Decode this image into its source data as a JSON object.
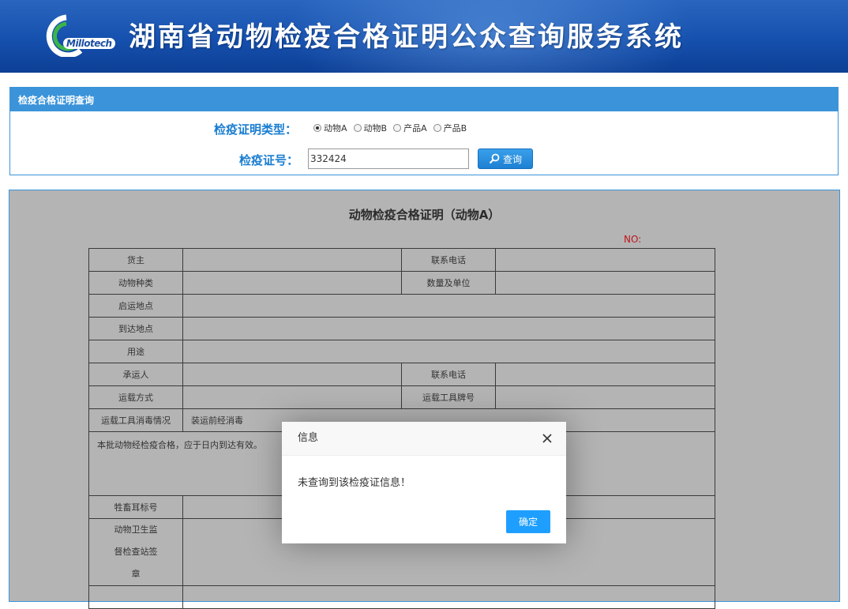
{
  "header": {
    "logo_text": "Millotech",
    "site_title": "湖南省动物检疫合格证明公众查询服务系统"
  },
  "query": {
    "panel_title": "检疫合格证明查询",
    "type_label": "检疫证明类型：",
    "types": [
      {
        "label": "动物A",
        "checked": true
      },
      {
        "label": "动物B",
        "checked": false
      },
      {
        "label": "产品A",
        "checked": false
      },
      {
        "label": "产品B",
        "checked": false
      }
    ],
    "cert_no_label": "检疫证号：",
    "cert_no_value": "332424",
    "search_button": "查询"
  },
  "certificate": {
    "title": "动物检疫合格证明（动物A）",
    "no_label": "NO:",
    "fields": {
      "owner": "货主",
      "phone": "联系电话",
      "animal_type": "动物种类",
      "quantity_unit": "数量及单位",
      "origin": "启运地点",
      "destination": "到达地点",
      "purpose": "用途",
      "carrier": "承运人",
      "carrier_phone": "联系电话",
      "transport_mode": "运载方式",
      "vehicle_plate": "运载工具牌号",
      "disinfection": "运载工具消毒情况",
      "disinfection_value": "装运前经消毒",
      "validity_note": "本批动物经检疫合格，应于日内到达有效。",
      "ear_tag": "牲畜耳标号",
      "station_line1": "动物卫生监",
      "station_line2": "督检查站签",
      "station_line3": "章"
    }
  },
  "dialog": {
    "title": "信息",
    "message": "未查询到该检疫证信息！",
    "ok_button": "确定"
  },
  "colors": {
    "banner": "#1550ae",
    "accent": "#3b94d9",
    "label_blue": "#1a7dd0",
    "no_red": "#c0141b",
    "ok_button": "#1e9fff",
    "cert_bg": "#b4b4b4"
  }
}
